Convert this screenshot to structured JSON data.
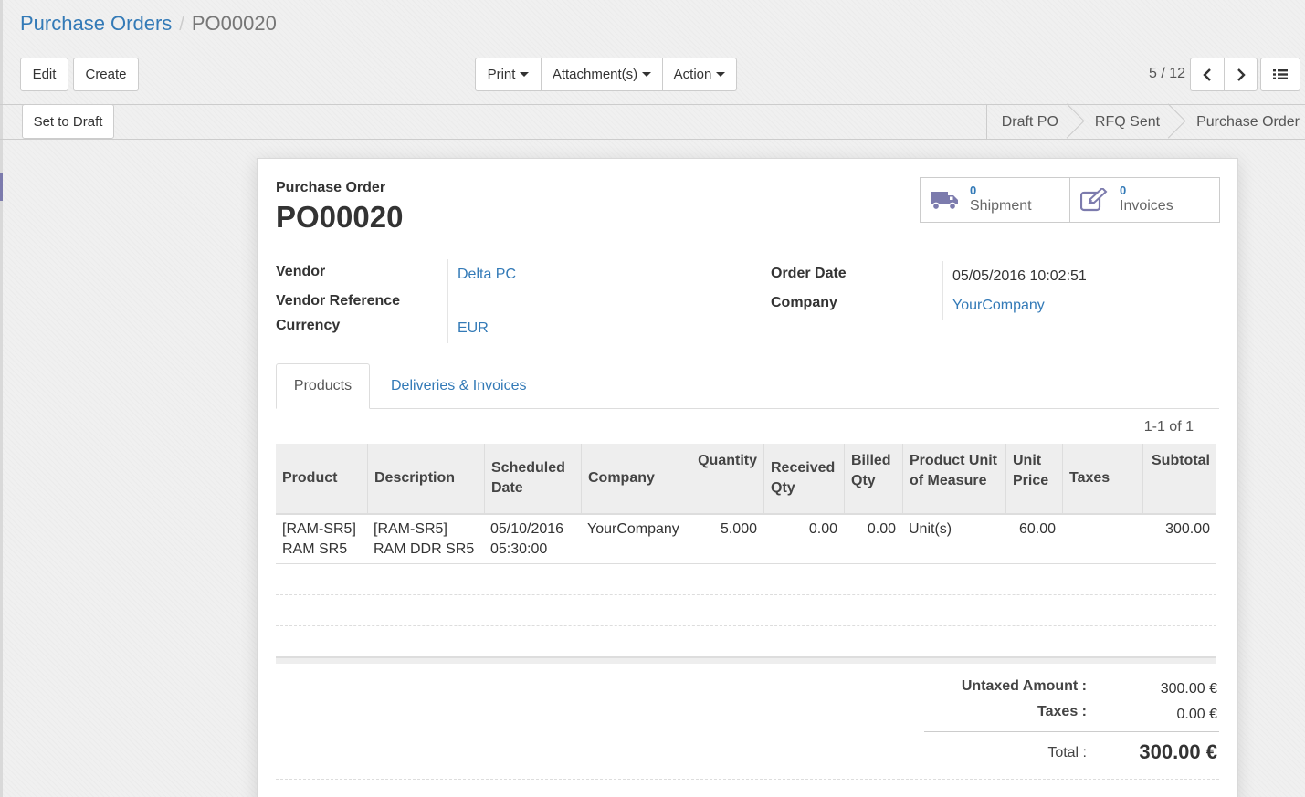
{
  "breadcrumb": {
    "parent": "Purchase Orders",
    "separator": "/",
    "current": "PO00020"
  },
  "toolbar": {
    "edit_label": "Edit",
    "create_label": "Create",
    "print_label": "Print",
    "attachments_label": "Attachment(s)",
    "action_label": "Action"
  },
  "pager": {
    "value": "5 / 12",
    "prev_icon": "chevron-left-icon",
    "next_icon": "chevron-right-icon",
    "list_view_icon": "list-icon"
  },
  "statusbar": {
    "set_to_draft_label": "Set to Draft",
    "stages": [
      {
        "label": "Draft PO",
        "active": false
      },
      {
        "label": "RFQ Sent",
        "active": false
      },
      {
        "label": "Purchase Order",
        "active": true
      }
    ]
  },
  "sheet": {
    "doc_type_label": "Purchase Order",
    "doc_name": "PO00020",
    "smart_buttons": [
      {
        "count": "0",
        "label": "Shipment",
        "icon": "truck-icon"
      },
      {
        "count": "0",
        "label": "Invoices",
        "icon": "edit-invoice-icon"
      }
    ],
    "fields_left": {
      "vendor_label": "Vendor",
      "vendor_value": "Delta PC",
      "vendor_ref_label": "Vendor Reference",
      "vendor_ref_value": "",
      "currency_label": "Currency",
      "currency_value": "EUR"
    },
    "fields_right": {
      "order_date_label": "Order Date",
      "order_date_value": "05/05/2016 10:02:51",
      "company_label": "Company",
      "company_value": "YourCompany"
    },
    "tabs": [
      "Products",
      "Deliveries & Invoices"
    ],
    "table_pager": "1-1 of 1",
    "table": {
      "columns": [
        "Product",
        "Description",
        "Scheduled Date",
        "Company",
        "Quantity",
        "Received Qty",
        "Billed Qty",
        "Product Unit of Measure",
        "Unit Price",
        "Taxes",
        "Subtotal"
      ],
      "rows": [
        {
          "product": "[RAM-SR5] RAM SR5",
          "description": "[RAM-SR5] RAM DDR SR5",
          "scheduled_date": "05/10/2016 05:30:00",
          "company": "YourCompany",
          "quantity": "5.000",
          "received_qty": "0.00",
          "billed_qty": "0.00",
          "uom": "Unit(s)",
          "unit_price": "60.00",
          "taxes": "",
          "subtotal": "300.00"
        }
      ]
    },
    "totals": {
      "untaxed_label": "Untaxed Amount :",
      "untaxed_value": "300.00 €",
      "taxes_label": "Taxes :",
      "taxes_value": "0.00 €",
      "total_label": "Total :",
      "total_value": "300.00 €"
    }
  },
  "colors": {
    "link": "#337ab7",
    "text": "#333333",
    "rail_accent": "#7c7bad"
  }
}
